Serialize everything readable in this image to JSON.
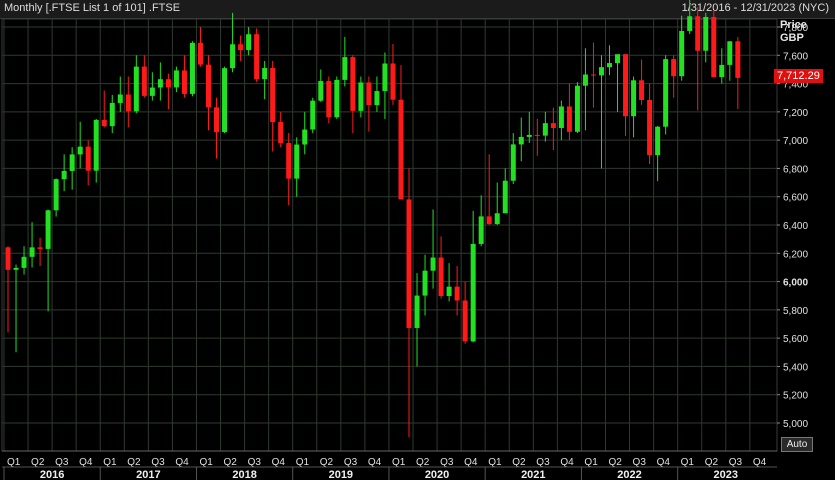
{
  "header": {
    "title": "Monthly [.FTSE List 1 of 101] .FTSE",
    "date_range": "1/31/2016 - 12/31/2023 (NYC)"
  },
  "price_axis": {
    "label": "Price",
    "currency": "GBP",
    "last_value": "7,712.29"
  },
  "controls": {
    "auto_label": "Auto"
  },
  "colors": {
    "up": "#22e022",
    "down": "#ff1a1a",
    "grid": "#2e3a2e",
    "background": "#000000"
  },
  "chart_data": {
    "type": "candlestick",
    "interval": "monthly",
    "ylim": [
      4800,
      8000
    ],
    "y_ticks": [
      "5,000",
      "5,200",
      "5,400",
      "5,600",
      "5,800",
      "6,000",
      "6,200",
      "6,400",
      "6,600",
      "6,800",
      "7,000",
      "7,200",
      "7,400",
      "7,600",
      "7,800"
    ],
    "x_quarter_labels": [
      "Q1",
      "Q2",
      "Q3",
      "Q4",
      "Q1",
      "Q2",
      "Q3",
      "Q4",
      "Q1",
      "Q2",
      "Q3",
      "Q4",
      "Q1",
      "Q2",
      "Q3",
      "Q4",
      "Q1",
      "Q2",
      "Q3",
      "Q4",
      "Q1",
      "Q2",
      "Q3",
      "Q4",
      "Q1",
      "Q2",
      "Q3",
      "Q4",
      "Q1",
      "Q2",
      "Q3",
      "Q4"
    ],
    "x_year_labels": [
      "2016",
      "2017",
      "2018",
      "2019",
      "2020",
      "2021",
      "2022",
      "2023"
    ],
    "candles": [
      {
        "date": "2016-01",
        "o": 6242,
        "h": 6250,
        "l": 5640,
        "c": 6083
      },
      {
        "date": "2016-02",
        "o": 6083,
        "h": 6120,
        "l": 5500,
        "c": 6097
      },
      {
        "date": "2016-03",
        "o": 6097,
        "h": 6250,
        "l": 6050,
        "c": 6175
      },
      {
        "date": "2016-04",
        "o": 6175,
        "h": 6420,
        "l": 6100,
        "c": 6242
      },
      {
        "date": "2016-05",
        "o": 6242,
        "h": 6310,
        "l": 6110,
        "c": 6231
      },
      {
        "date": "2016-06",
        "o": 6231,
        "h": 6510,
        "l": 5790,
        "c": 6504
      },
      {
        "date": "2016-07",
        "o": 6504,
        "h": 6730,
        "l": 6460,
        "c": 6724
      },
      {
        "date": "2016-08",
        "o": 6724,
        "h": 6900,
        "l": 6640,
        "c": 6782
      },
      {
        "date": "2016-09",
        "o": 6782,
        "h": 6950,
        "l": 6650,
        "c": 6899
      },
      {
        "date": "2016-10",
        "o": 6899,
        "h": 7130,
        "l": 6800,
        "c": 6954
      },
      {
        "date": "2016-11",
        "o": 6954,
        "h": 7000,
        "l": 6680,
        "c": 6784
      },
      {
        "date": "2016-12",
        "o": 6784,
        "h": 7150,
        "l": 6700,
        "c": 7143
      },
      {
        "date": "2017-01",
        "o": 7143,
        "h": 7350,
        "l": 7090,
        "c": 7099
      },
      {
        "date": "2017-02",
        "o": 7099,
        "h": 7320,
        "l": 7050,
        "c": 7263
      },
      {
        "date": "2017-03",
        "o": 7263,
        "h": 7450,
        "l": 7200,
        "c": 7323
      },
      {
        "date": "2017-04",
        "o": 7323,
        "h": 7450,
        "l": 7090,
        "c": 7204
      },
      {
        "date": "2017-05",
        "o": 7204,
        "h": 7600,
        "l": 7190,
        "c": 7520
      },
      {
        "date": "2017-06",
        "o": 7520,
        "h": 7600,
        "l": 7300,
        "c": 7313
      },
      {
        "date": "2017-07",
        "o": 7313,
        "h": 7480,
        "l": 7280,
        "c": 7372
      },
      {
        "date": "2017-08",
        "o": 7372,
        "h": 7550,
        "l": 7280,
        "c": 7431
      },
      {
        "date": "2017-09",
        "o": 7431,
        "h": 7470,
        "l": 7220,
        "c": 7373
      },
      {
        "date": "2017-10",
        "o": 7373,
        "h": 7520,
        "l": 7340,
        "c": 7493
      },
      {
        "date": "2017-11",
        "o": 7493,
        "h": 7600,
        "l": 7300,
        "c": 7327
      },
      {
        "date": "2017-12",
        "o": 7327,
        "h": 7700,
        "l": 7310,
        "c": 7688
      },
      {
        "date": "2018-01",
        "o": 7688,
        "h": 7800,
        "l": 7520,
        "c": 7534
      },
      {
        "date": "2018-02",
        "o": 7534,
        "h": 7600,
        "l": 7070,
        "c": 7232
      },
      {
        "date": "2018-03",
        "o": 7232,
        "h": 7300,
        "l": 6870,
        "c": 7057
      },
      {
        "date": "2018-04",
        "o": 7057,
        "h": 7520,
        "l": 7050,
        "c": 7509
      },
      {
        "date": "2018-05",
        "o": 7509,
        "h": 7900,
        "l": 7480,
        "c": 7678
      },
      {
        "date": "2018-06",
        "o": 7678,
        "h": 7740,
        "l": 7560,
        "c": 7637
      },
      {
        "date": "2018-07",
        "o": 7637,
        "h": 7800,
        "l": 7600,
        "c": 7749
      },
      {
        "date": "2018-08",
        "o": 7749,
        "h": 7790,
        "l": 7410,
        "c": 7432
      },
      {
        "date": "2018-09",
        "o": 7432,
        "h": 7560,
        "l": 7290,
        "c": 7510
      },
      {
        "date": "2018-10",
        "o": 7510,
        "h": 7560,
        "l": 6920,
        "c": 7128
      },
      {
        "date": "2018-11",
        "o": 7128,
        "h": 7200,
        "l": 6950,
        "c": 6980
      },
      {
        "date": "2018-12",
        "o": 6980,
        "h": 7050,
        "l": 6540,
        "c": 6728
      },
      {
        "date": "2019-01",
        "o": 6728,
        "h": 7020,
        "l": 6600,
        "c": 6969
      },
      {
        "date": "2019-02",
        "o": 6969,
        "h": 7200,
        "l": 6900,
        "c": 7075
      },
      {
        "date": "2019-03",
        "o": 7075,
        "h": 7300,
        "l": 7050,
        "c": 7279
      },
      {
        "date": "2019-04",
        "o": 7279,
        "h": 7500,
        "l": 7270,
        "c": 7418
      },
      {
        "date": "2019-05",
        "o": 7418,
        "h": 7450,
        "l": 7120,
        "c": 7162
      },
      {
        "date": "2019-06",
        "o": 7162,
        "h": 7450,
        "l": 7150,
        "c": 7426
      },
      {
        "date": "2019-07",
        "o": 7426,
        "h": 7730,
        "l": 7380,
        "c": 7587
      },
      {
        "date": "2019-08",
        "o": 7587,
        "h": 7600,
        "l": 7050,
        "c": 7207
      },
      {
        "date": "2019-09",
        "o": 7207,
        "h": 7450,
        "l": 7160,
        "c": 7408
      },
      {
        "date": "2019-10",
        "o": 7408,
        "h": 7450,
        "l": 7060,
        "c": 7248
      },
      {
        "date": "2019-11",
        "o": 7248,
        "h": 7450,
        "l": 7200,
        "c": 7347
      },
      {
        "date": "2019-12",
        "o": 7347,
        "h": 7620,
        "l": 7150,
        "c": 7542
      },
      {
        "date": "2020-01",
        "o": 7542,
        "h": 7680,
        "l": 7250,
        "c": 7286
      },
      {
        "date": "2020-02",
        "o": 7286,
        "h": 7530,
        "l": 6580,
        "c": 6581
      },
      {
        "date": "2020-03",
        "o": 6581,
        "h": 6800,
        "l": 4900,
        "c": 5672
      },
      {
        "date": "2020-04",
        "o": 5672,
        "h": 6060,
        "l": 5400,
        "c": 5901
      },
      {
        "date": "2020-05",
        "o": 5901,
        "h": 6190,
        "l": 5760,
        "c": 6077
      },
      {
        "date": "2020-06",
        "o": 6077,
        "h": 6510,
        "l": 5950,
        "c": 6170
      },
      {
        "date": "2020-07",
        "o": 6170,
        "h": 6320,
        "l": 5880,
        "c": 5898
      },
      {
        "date": "2020-08",
        "o": 5898,
        "h": 6130,
        "l": 5860,
        "c": 5964
      },
      {
        "date": "2020-09",
        "o": 5964,
        "h": 6110,
        "l": 5760,
        "c": 5866
      },
      {
        "date": "2020-10",
        "o": 5866,
        "h": 6000,
        "l": 5560,
        "c": 5577
      },
      {
        "date": "2020-11",
        "o": 5577,
        "h": 6500,
        "l": 5570,
        "c": 6266
      },
      {
        "date": "2020-12",
        "o": 6266,
        "h": 6610,
        "l": 6250,
        "c": 6461
      },
      {
        "date": "2021-01",
        "o": 6461,
        "h": 6900,
        "l": 6400,
        "c": 6407
      },
      {
        "date": "2021-02",
        "o": 6407,
        "h": 6700,
        "l": 6400,
        "c": 6483
      },
      {
        "date": "2021-03",
        "o": 6483,
        "h": 6800,
        "l": 6500,
        "c": 6713
      },
      {
        "date": "2021-04",
        "o": 6713,
        "h": 7050,
        "l": 6690,
        "c": 6970
      },
      {
        "date": "2021-05",
        "o": 6970,
        "h": 7160,
        "l": 6850,
        "c": 7023
      },
      {
        "date": "2021-06",
        "o": 7023,
        "h": 7200,
        "l": 6980,
        "c": 7037
      },
      {
        "date": "2021-07",
        "o": 7037,
        "h": 7150,
        "l": 6890,
        "c": 7032
      },
      {
        "date": "2021-08",
        "o": 7032,
        "h": 7200,
        "l": 6990,
        "c": 7120
      },
      {
        "date": "2021-09",
        "o": 7120,
        "h": 7230,
        "l": 6930,
        "c": 7086
      },
      {
        "date": "2021-10",
        "o": 7086,
        "h": 7280,
        "l": 7000,
        "c": 7238
      },
      {
        "date": "2021-11",
        "o": 7238,
        "h": 7400,
        "l": 7000,
        "c": 7059
      },
      {
        "date": "2021-12",
        "o": 7059,
        "h": 7410,
        "l": 7050,
        "c": 7385
      },
      {
        "date": "2022-01",
        "o": 7385,
        "h": 7650,
        "l": 7070,
        "c": 7464
      },
      {
        "date": "2022-02",
        "o": 7464,
        "h": 7690,
        "l": 7230,
        "c": 7458
      },
      {
        "date": "2022-03",
        "o": 7458,
        "h": 7600,
        "l": 6800,
        "c": 7516
      },
      {
        "date": "2022-04",
        "o": 7516,
        "h": 7670,
        "l": 7460,
        "c": 7545
      },
      {
        "date": "2022-05",
        "o": 7545,
        "h": 7600,
        "l": 7200,
        "c": 7608
      },
      {
        "date": "2022-06",
        "o": 7608,
        "h": 7610,
        "l": 7030,
        "c": 7169
      },
      {
        "date": "2022-07",
        "o": 7169,
        "h": 7450,
        "l": 7020,
        "c": 7423
      },
      {
        "date": "2022-08",
        "o": 7423,
        "h": 7570,
        "l": 7250,
        "c": 7284
      },
      {
        "date": "2022-09",
        "o": 7284,
        "h": 7400,
        "l": 6830,
        "c": 6894
      },
      {
        "date": "2022-10",
        "o": 6894,
        "h": 7100,
        "l": 6710,
        "c": 7095
      },
      {
        "date": "2022-11",
        "o": 7095,
        "h": 7600,
        "l": 7040,
        "c": 7573
      },
      {
        "date": "2022-12",
        "o": 7573,
        "h": 7600,
        "l": 7300,
        "c": 7452
      },
      {
        "date": "2023-01",
        "o": 7452,
        "h": 7880,
        "l": 7420,
        "c": 7772
      },
      {
        "date": "2023-02",
        "o": 7772,
        "h": 8050,
        "l": 7750,
        "c": 7876
      },
      {
        "date": "2023-03",
        "o": 7876,
        "h": 7940,
        "l": 7210,
        "c": 7632
      },
      {
        "date": "2023-04",
        "o": 7632,
        "h": 7900,
        "l": 7550,
        "c": 7871
      },
      {
        "date": "2023-05",
        "o": 7871,
        "h": 7920,
        "l": 7550,
        "c": 7446
      },
      {
        "date": "2023-06",
        "o": 7446,
        "h": 7650,
        "l": 7400,
        "c": 7532
      },
      {
        "date": "2023-07",
        "o": 7532,
        "h": 7700,
        "l": 7420,
        "c": 7699
      },
      {
        "date": "2023-08",
        "o": 7699,
        "h": 7730,
        "l": 7220,
        "c": 7440
      }
    ]
  }
}
